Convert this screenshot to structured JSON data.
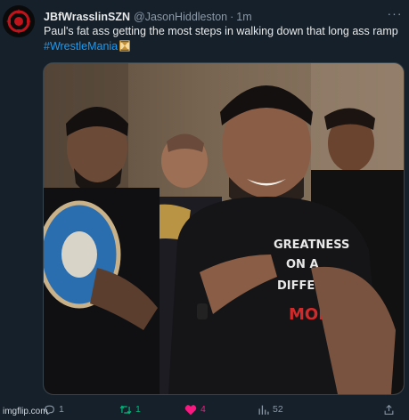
{
  "tweet": {
    "display_name": "JBfWrasslinSZN",
    "handle": "@JasonHiddleston",
    "separator": "·",
    "time": "1m",
    "more_label": "···",
    "text": "Paul's fat ass getting the most steps in walking down that long ass ramp",
    "hashtag": "#WrestleMania",
    "emoji_icon": "hourglass-icon",
    "shirt_text": [
      "GREATNESS",
      "ON A",
      "DIFFERENT",
      "MODE"
    ]
  },
  "actions": {
    "replies": "1",
    "retweets": "1",
    "likes": "4",
    "views": "52"
  },
  "watermark": "imgflip.com",
  "colors": {
    "background": "#15202b",
    "link": "#1d9bf0",
    "retweet_active": "#00ba7c",
    "like_active": "#f91880",
    "muted": "#8b98a5"
  }
}
